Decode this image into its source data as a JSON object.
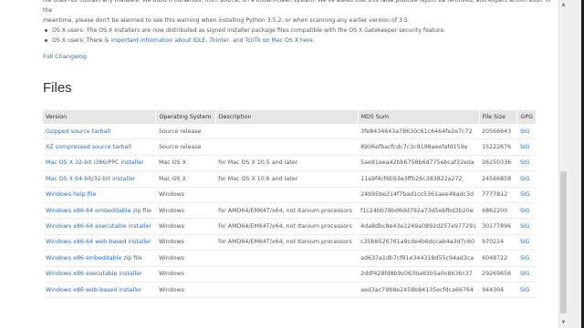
{
  "notes": {
    "line0": "file does not contain any malware. We build it ourselves, from source, on a known-clean system. We've asked that this false positive report be removed, and expect action soon. In the",
    "line1": "meantime, please don't be alarmed to see this warning when installing Python 3.5.2, or when scanning any earlier version of 3.5.",
    "osx1_prefix": "OS X users:",
    "osx1_text": " The OS X installers are now distributed as signed installer package files compatible with the OS X Gatekeeper security feature.",
    "osx2_prefix": "OS X users:",
    "osx2_text": " There is ",
    "osx2_link": "important information about IDLE, Tkinter, and Tcl/Tk on Mac OS X here",
    "osx2_end": "."
  },
  "changelog_link": "Full Changelog",
  "files_heading": "Files",
  "table": {
    "headers": [
      "Version",
      "Operating System",
      "Description",
      "MD5 Sum",
      "File Size",
      "GPG"
    ],
    "rows": [
      {
        "version": "Gzipped source tarball",
        "os": "Source release",
        "desc": "",
        "md5": "3fe8434643a78630c61c6464fe2e7c72",
        "size": "20566643",
        "gpg": "SIG"
      },
      {
        "version": "XZ compressed source tarball",
        "os": "Source release",
        "desc": "",
        "md5": "8906efbacfcdc7c3c9198aeefafd159e",
        "size": "15222676",
        "gpg": "SIG"
      },
      {
        "version": "Mac OS X 32-bit i386/PPC installer",
        "os": "Mac OS X",
        "desc": "for Mac OS X 10.5 and later",
        "md5": "5ae81eea42bb6758b6d775ebcaf32eda",
        "size": "26250336",
        "gpg": "SIG"
      },
      {
        "version": "Mac OS X 64-bit/32-bit installer",
        "os": "Mac OS X",
        "desc": "for Mac OS X 10.6 and later",
        "md5": "11a9f4cf6b93e3ffb26c383822a272",
        "size": "24566858",
        "gpg": "SIG"
      },
      {
        "version": "Windows help file",
        "os": "Windows",
        "desc": "",
        "md5": "24b95be314f7bad1cc5361aee49adc3d",
        "size": "7777812",
        "gpg": "SIG"
      },
      {
        "version": "Windows x86-64 embeddable zip file",
        "os": "Windows",
        "desc": "for AMD64/EM64T/x64, not Itanium processors",
        "md5": "f1c24bb78bd6dd792a73d5ebfbd3b20e",
        "size": "6862200",
        "gpg": "SIG"
      },
      {
        "version": "Windows x86-64 executable installer",
        "os": "Windows",
        "desc": "for AMD64/EM64T/x64, not Itanium processors",
        "md5": "4da8dbc8e43e2249a0892d257e977291",
        "size": "30177896",
        "gpg": "SIG"
      },
      {
        "version": "Windows x86-64 web-based installer",
        "os": "Windows",
        "desc": "for AMD64/EM64T/x64, not Itanium processors",
        "md5": "c35b6526761a9cde4b6dccab4a3d7c60",
        "size": "970224",
        "gpg": "SIG"
      },
      {
        "version": "Windows x86 embeddable zip file",
        "os": "Windows",
        "desc": "",
        "md5": "ad637a1db7cf91e344318d55c94ad3ca",
        "size": "6048722",
        "gpg": "SIG"
      },
      {
        "version": "Windows x86 executable installer",
        "os": "Windows",
        "desc": "",
        "md5": "2ddf428fd8b9c063ba65b5a0c8636c37",
        "size": "29269656",
        "gpg": "SIG"
      },
      {
        "version": "Windows x86 web-based installer",
        "os": "Windows",
        "desc": "",
        "md5": "aed3ac79b8e2458b84135ecfdca66764",
        "size": "944304",
        "gpg": "SIG"
      }
    ]
  },
  "scrollbar": {
    "up_arrow": "▲",
    "down_arrow": "▼"
  }
}
